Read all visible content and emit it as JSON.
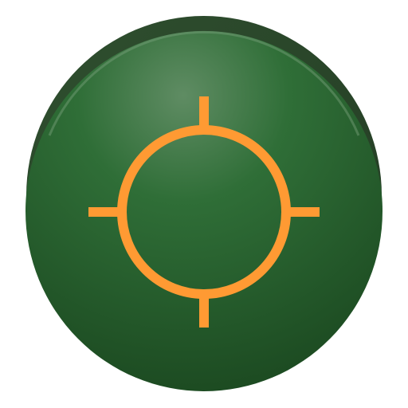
{
  "icon": {
    "name": "gps-crosshair-icon",
    "colors": {
      "base_dark": "#2f4f2f",
      "base_mid": "#2f6e37",
      "base_deep": "#1d4a22",
      "highlight": "#6f9a72",
      "crosshair": "#ff9a33"
    }
  }
}
